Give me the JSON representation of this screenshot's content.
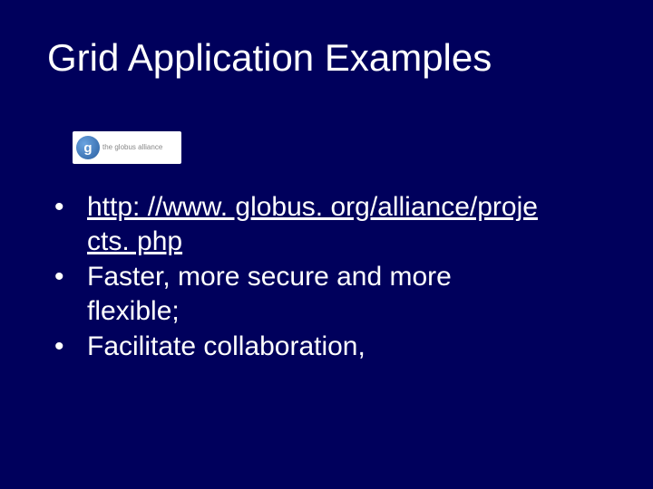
{
  "slide": {
    "title": "Grid Application Examples",
    "logo": {
      "glyph": "g",
      "text": "the globus alliance"
    },
    "bullets": [
      {
        "marker": "•",
        "link_line1": "http: //www. globus. org/alliance/proje",
        "link_line2": "cts. php"
      },
      {
        "marker": "•",
        "text_line1": "Faster, more secure and more",
        "text_line2": "flexible;"
      },
      {
        "marker": "•",
        "text_line1": "Facilitate collaboration,"
      }
    ]
  }
}
